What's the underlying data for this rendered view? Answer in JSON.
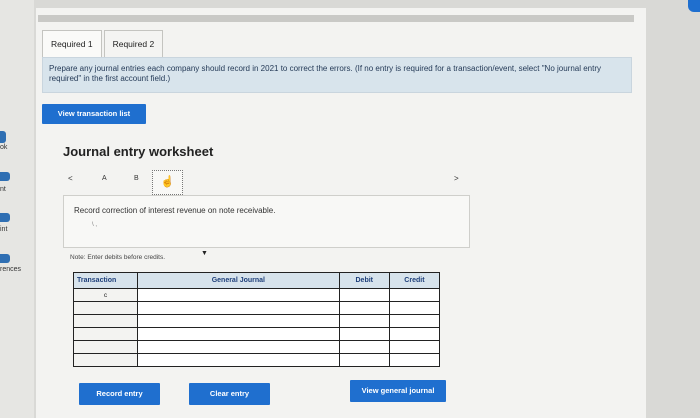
{
  "sidebar": {
    "items": [
      {
        "label": "ok"
      },
      {
        "label": "nt"
      },
      {
        "label": "int"
      },
      {
        "label": "rences"
      }
    ]
  },
  "tabs": [
    {
      "label": "Required 1",
      "active": true
    },
    {
      "label": "Required 2",
      "active": false
    }
  ],
  "instructions": {
    "text": "Prepare any journal entries each company should record in 2021 to correct the errors. (If no entry is required for a transaction/event, select \"No journal entry required\" in the first account field.)"
  },
  "buttons": {
    "view_transaction_list": "View transaction list",
    "record_entry": "Record entry",
    "clear_entry": "Clear entry",
    "view_general_journal": "View general journal"
  },
  "worksheet": {
    "title": "Journal entry worksheet",
    "nav_prev": "<",
    "nav_next": ">",
    "entries": [
      "A",
      "B",
      "C"
    ],
    "record_text": "Record correction of interest revenue on note receivable.",
    "record_mark": "\\ ,",
    "note": "Note: Enter debits before credits."
  },
  "journal_table": {
    "headers": {
      "transaction": "Transaction",
      "general_journal": "General Journal",
      "debit": "Debit",
      "credit": "Credit"
    },
    "rows": [
      {
        "transaction": "c"
      },
      {
        "transaction": ""
      },
      {
        "transaction": ""
      },
      {
        "transaction": ""
      },
      {
        "transaction": ""
      },
      {
        "transaction": ""
      }
    ]
  },
  "colors": {
    "accent": "#1f6fcf",
    "instruction_bg": "#d8e4ec",
    "table_header_bg": "#d7e3ec"
  }
}
